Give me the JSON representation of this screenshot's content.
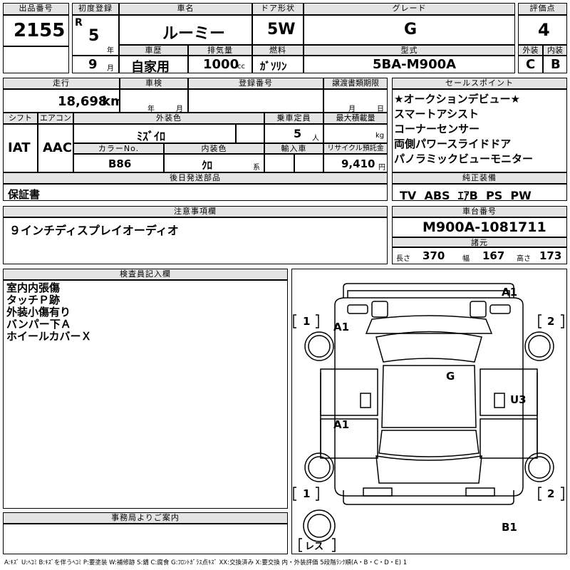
{
  "headers": {
    "lot_no": "出品番号",
    "first_reg": "初度登録",
    "model_name": "車名",
    "doors": "ドア形状",
    "grade": "グレード",
    "score": "評価点",
    "history": "車歴",
    "displacement": "排気量",
    "fuel": "燃料",
    "model_code": "型式",
    "exterior": "外装",
    "interior": "内装",
    "mileage": "走行",
    "inspection": "車検",
    "reg_no": "登録番号",
    "transfer_deadline": "譲渡書類期限",
    "sales_points": "セールスポイント",
    "shift": "シフト",
    "aircon": "エアコン",
    "body_color": "外装色",
    "capacity": "乗車定員",
    "max_load": "最大積載量",
    "color_no": "カラーNo.",
    "interior_color": "内装色",
    "import": "輸入車",
    "recycle_fee": "リサイクル預託金",
    "later_parts": "後日発送部品",
    "genuine_equipment": "純正装備",
    "caution": "注意事項欄",
    "chassis_no": "車台番号",
    "specs": "諸元",
    "inspector_notes": "検査員記入欄",
    "office_notice": "事務局よりご案内"
  },
  "vehicle": {
    "lot_no": "2155",
    "era": "R",
    "year": "5",
    "year_unit": "年",
    "month": "9",
    "month_unit": "月",
    "model_name": "ルーミー",
    "doors": "5W",
    "grade": "G",
    "score": "4",
    "history": "自家用",
    "displacement": "1000",
    "displacement_unit": "cc",
    "fuel": "ｶﾞｿﾘﾝ",
    "model_code": "5BA-M900A",
    "exterior_grade": "C",
    "interior_grade": "B",
    "mileage": "18,698",
    "mileage_unit": "km",
    "inspection_year_unit": "年",
    "inspection_month_unit": "月",
    "transfer_month_unit": "月",
    "transfer_day_unit": "日",
    "shift": "IAT",
    "aircon": "AAC",
    "body_color": "ﾐｽﾞｲﾛ",
    "capacity": "5",
    "capacity_unit": "人",
    "max_load_unit": "kg",
    "color_no": "B86",
    "interior_color": "ｸﾛ",
    "interior_color_suffix": "系",
    "recycle_fee": "9,410",
    "recycle_unit": "円",
    "later_parts": "保証書",
    "equipment": "TV  ABS  ｴｱB  PS  PW",
    "caution": "９インチディスプレイオーディオ",
    "chassis_no": "M900A-1081711",
    "length_label": "長さ",
    "length": "370",
    "width_label": "幅",
    "width": "167",
    "height_label": "高さ",
    "height": "173"
  },
  "sales_points": [
    "★オークションデビュー★",
    "スマートアシスト",
    "コーナーセンサー",
    "両側パワースライドドア",
    "パノラミックビューモニター"
  ],
  "inspector_notes": [
    "室内内張傷",
    "タッチＰ跡",
    "外装小傷有り",
    "バンパー下Ａ",
    "ホイールカバーＸ"
  ],
  "diagram": {
    "marks": [
      "A1",
      "A1",
      "G",
      "U3",
      "A1",
      "B1"
    ],
    "wheel_labels": [
      "1",
      "2",
      "1",
      "2"
    ],
    "spare": "レス"
  },
  "legend": "A:ｷｽﾞ U:ﾍｺﾐ B:ｷｽﾞを伴うﾍｺﾐ P:要塗装 W:補修跡 S:錆 C:腐食 G:ﾌﾛﾝﾄｶﾞﾗｽ点ｷｽﾞ XX:交換済み X:要交換 内・外装評価 5段階ﾗﾝｸ順(A・B・C・D・E) 1"
}
